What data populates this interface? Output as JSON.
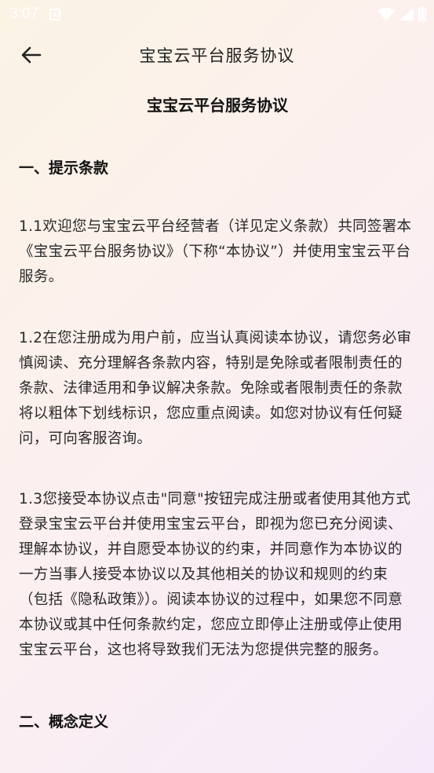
{
  "status_bar": {
    "time": "3:07"
  },
  "header": {
    "title": "宝宝云平台服务协议"
  },
  "document": {
    "title": "宝宝云平台服务协议",
    "sections": [
      {
        "heading": "一、提示条款",
        "paragraphs": [
          "1.1欢迎您与宝宝云平台经营者（详见定义条款）共同签署本《宝宝云平台服务协议》（下称“本协议”）并使用宝宝云平台服务。",
          "1.2在您注册成为用户前，应当认真阅读本协议，请您务必审慎阅读、充分理解各条款内容，特别是免除或者限制责任的条款、法律适用和争议解决条款。免除或者限制责任的条款将以粗体下划线标识，您应重点阅读。如您对协议有任何疑问，可向客服咨询。",
          "1.3您接受本协议点击\"同意\"按钮完成注册或者使用其他方式登录宝宝云平台并使用宝宝云平台，即视为您已充分阅读、理解本协议，并自愿受本协议的约束，并同意作为本协议的一方当事人接受本协议以及其他相关的协议和规则的约束（包括《隐私政策》）。阅读本协议的过程中，如果您不同意本协议或其中任何条款约定，您应立即停止注册或停止使用宝宝云平台，这也将导致我们无法为您提供完整的服务。"
        ]
      },
      {
        "heading": "二、概念定义",
        "paragraphs": []
      }
    ]
  }
}
